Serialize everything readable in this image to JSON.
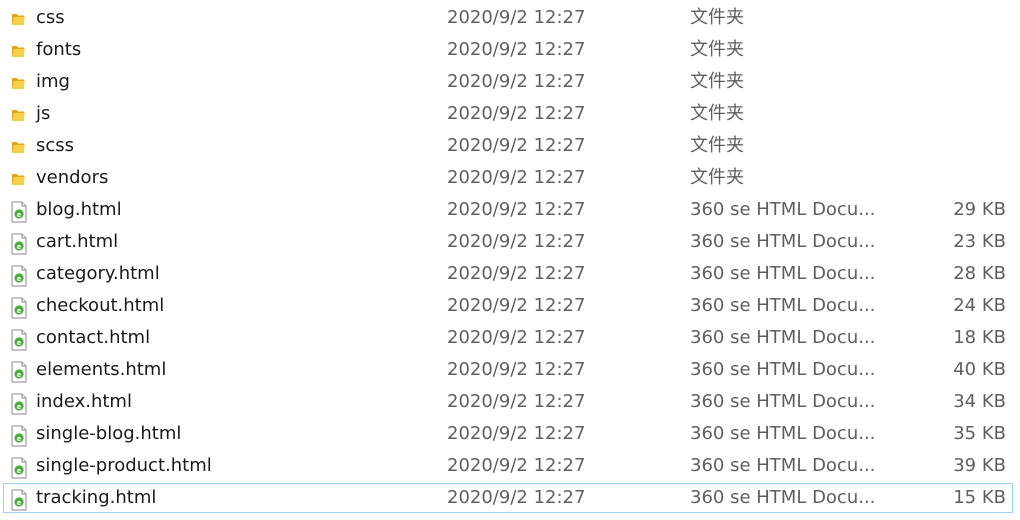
{
  "files": [
    {
      "name": "css",
      "modified": "2020/9/2 12:27",
      "type": "文件夹",
      "size": "",
      "icon": "folder-icon"
    },
    {
      "name": "fonts",
      "modified": "2020/9/2 12:27",
      "type": "文件夹",
      "size": "",
      "icon": "folder-icon"
    },
    {
      "name": "img",
      "modified": "2020/9/2 12:27",
      "type": "文件夹",
      "size": "",
      "icon": "folder-icon"
    },
    {
      "name": "js",
      "modified": "2020/9/2 12:27",
      "type": "文件夹",
      "size": "",
      "icon": "folder-icon"
    },
    {
      "name": "scss",
      "modified": "2020/9/2 12:27",
      "type": "文件夹",
      "size": "",
      "icon": "folder-icon"
    },
    {
      "name": "vendors",
      "modified": "2020/9/2 12:27",
      "type": "文件夹",
      "size": "",
      "icon": "folder-icon"
    },
    {
      "name": "blog.html",
      "modified": "2020/9/2 12:27",
      "type": "360 se HTML Docu...",
      "size": "29 KB",
      "icon": "html-file-icon"
    },
    {
      "name": "cart.html",
      "modified": "2020/9/2 12:27",
      "type": "360 se HTML Docu...",
      "size": "23 KB",
      "icon": "html-file-icon"
    },
    {
      "name": "category.html",
      "modified": "2020/9/2 12:27",
      "type": "360 se HTML Docu...",
      "size": "28 KB",
      "icon": "html-file-icon"
    },
    {
      "name": "checkout.html",
      "modified": "2020/9/2 12:27",
      "type": "360 se HTML Docu...",
      "size": "24 KB",
      "icon": "html-file-icon"
    },
    {
      "name": "contact.html",
      "modified": "2020/9/2 12:27",
      "type": "360 se HTML Docu...",
      "size": "18 KB",
      "icon": "html-file-icon"
    },
    {
      "name": "elements.html",
      "modified": "2020/9/2 12:27",
      "type": "360 se HTML Docu...",
      "size": "40 KB",
      "icon": "html-file-icon"
    },
    {
      "name": "index.html",
      "modified": "2020/9/2 12:27",
      "type": "360 se HTML Docu...",
      "size": "34 KB",
      "icon": "html-file-icon"
    },
    {
      "name": "single-blog.html",
      "modified": "2020/9/2 12:27",
      "type": "360 se HTML Docu...",
      "size": "35 KB",
      "icon": "html-file-icon"
    },
    {
      "name": "single-product.html",
      "modified": "2020/9/2 12:27",
      "type": "360 se HTML Docu...",
      "size": "39 KB",
      "icon": "html-file-icon"
    },
    {
      "name": "tracking.html",
      "modified": "2020/9/2 12:27",
      "type": "360 se HTML Docu...",
      "size": "15 KB",
      "icon": "html-file-icon",
      "focused": true
    }
  ]
}
